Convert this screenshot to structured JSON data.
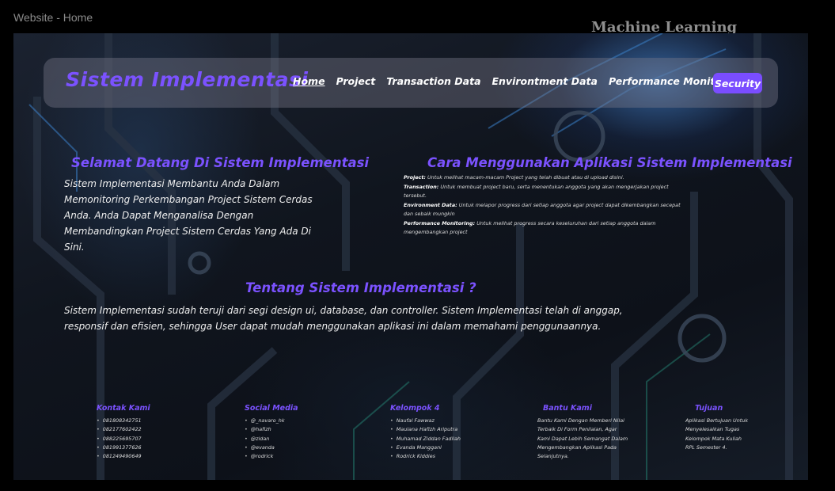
{
  "window": {
    "label": "Website - Home",
    "corner_title": "Machine Learning"
  },
  "nav": {
    "brand": "Sistem Implementasi",
    "items": [
      "Home",
      "Project",
      "Transaction Data",
      "Environtment Data",
      "Performance Monitoring"
    ],
    "security_button": "Security"
  },
  "welcome": {
    "title": "Selamat Datang Di Sistem Implementasi",
    "text": "Sistem Implementasi Membantu Anda Dalam Memonitoring Perkembangan Project Sistem Cerdas Anda. Anda Dapat Menganalisa Dengan Membandingkan Project Sistem Cerdas Yang Ada Di Sini."
  },
  "howto": {
    "title": "Cara Menggunakan Aplikasi Sistem Implementasi",
    "items": [
      {
        "term": "Project:",
        "desc": "Untuk melihat macam-macam Project yang telah dibuat atau di upload disini."
      },
      {
        "term": "Transaction:",
        "desc": "Untuk membuat project baru, serta menentukan anggota yang akan mengerjakan project tersebut."
      },
      {
        "term": "Environment Data:",
        "desc": "Untuk melapor progress dari setiap anggota agar project dapat dikembangkan secepat dan sebaik mungkin"
      },
      {
        "term": "Performance Monitoring:",
        "desc": "Untuk melihat progress secara keseluruhan dari setiap anggota dalam mengembangkan project"
      }
    ]
  },
  "about": {
    "title": "Tentang Sistem Implementasi ?",
    "text": "Sistem Implementasi sudah teruji dari segi design ui, database, dan controller. Sistem Implementasi telah di anggap, responsif dan efisien, sehingga User dapat mudah menggunakan aplikasi ini dalam memahami penggunaannya."
  },
  "footer": {
    "contact": {
      "title": "Kontak Kami",
      "items": [
        "081808342751",
        "082177602422",
        "088225695707",
        "081991377626",
        "081249490649"
      ]
    },
    "social": {
      "title": "Social Media",
      "items": [
        "@_navaro_hk",
        "@hafizh",
        "@zidan",
        "@evanda",
        "@rodrick"
      ]
    },
    "group": {
      "title": "Kelompok 4",
      "items": [
        "Naufal Fawwaz",
        "Maulana Hafizh Ariputra",
        "Muhamad Ziddan Fadilah",
        "Evanda Manggani",
        "Rodrick Kiddies"
      ]
    },
    "help": {
      "title": "Bantu Kami",
      "text": "Bantu Kami Dengan Memberi Nilai Terbaik Di Form Penilaian, Agar Kami Dapat Lebih Semangat Dalam Mengembangkan Aplikasi Pada Selanjutnya."
    },
    "goal": {
      "title": "Tujuan",
      "text": "Aplikasi Bertujuan Untuk Menyelesaikan Tugas Kelompok Mata Kuliah RPL Semester 4."
    }
  },
  "colors": {
    "accent": "#7b52ff",
    "button": "#7a4dff",
    "text": "#eeeeee"
  }
}
